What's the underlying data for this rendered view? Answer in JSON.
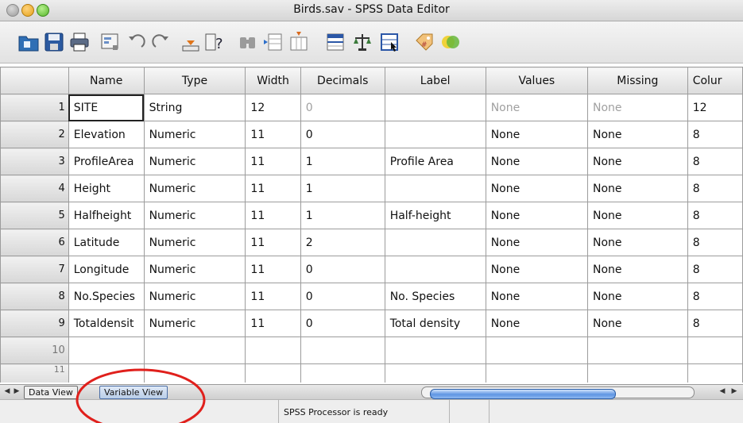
{
  "window": {
    "title": "Birds.sav - SPSS Data Editor"
  },
  "toolbar": {
    "icons": [
      "open-folder-icon",
      "save-icon",
      "print-icon",
      "dialog-recall-icon",
      "undo-icon",
      "redo-icon",
      "goto-case-icon",
      "variables-icon",
      "find-icon",
      "insert-cases-icon",
      "insert-variable-icon",
      "split-file-icon",
      "weight-cases-icon",
      "select-cases-icon",
      "value-labels-icon",
      "use-sets-icon"
    ]
  },
  "grid": {
    "columns": [
      "Name",
      "Type",
      "Width",
      "Decimals",
      "Label",
      "Values",
      "Missing",
      "Colur"
    ],
    "rows": [
      {
        "num": "1",
        "name": "SITE",
        "type": "String",
        "width": "12",
        "decimals": "0",
        "label": "",
        "values": "None",
        "missing": "None",
        "columns": "12"
      },
      {
        "num": "2",
        "name": "Elevation",
        "type": "Numeric",
        "width": "11",
        "decimals": "0",
        "label": "",
        "values": "None",
        "missing": "None",
        "columns": "8"
      },
      {
        "num": "3",
        "name": "ProfileArea",
        "type": "Numeric",
        "width": "11",
        "decimals": "1",
        "label": "Profile Area",
        "values": "None",
        "missing": "None",
        "columns": "8"
      },
      {
        "num": "4",
        "name": "Height",
        "type": "Numeric",
        "width": "11",
        "decimals": "1",
        "label": "",
        "values": "None",
        "missing": "None",
        "columns": "8"
      },
      {
        "num": "5",
        "name": "Halfheight",
        "type": "Numeric",
        "width": "11",
        "decimals": "1",
        "label": "Half-height",
        "values": "None",
        "missing": "None",
        "columns": "8"
      },
      {
        "num": "6",
        "name": "Latitude",
        "type": "Numeric",
        "width": "11",
        "decimals": "2",
        "label": "",
        "values": "None",
        "missing": "None",
        "columns": "8"
      },
      {
        "num": "7",
        "name": "Longitude",
        "type": "Numeric",
        "width": "11",
        "decimals": "0",
        "label": "",
        "values": "None",
        "missing": "None",
        "columns": "8"
      },
      {
        "num": "8",
        "name": "No.Species",
        "type": "Numeric",
        "width": "11",
        "decimals": "0",
        "label": "No. Species",
        "values": "None",
        "missing": "None",
        "columns": "8"
      },
      {
        "num": "9",
        "name": "Totaldensit",
        "type": "Numeric",
        "width": "11",
        "decimals": "0",
        "label": "Total density",
        "values": "None",
        "missing": "None",
        "columns": "8"
      }
    ],
    "empty_rows": [
      "10",
      "11"
    ]
  },
  "tabs": {
    "data_view": "Data View",
    "variable_view": "Variable View"
  },
  "status": {
    "text": "SPSS Processor  is ready"
  },
  "colors": {
    "annotation": "#e0201c",
    "scroll_thumb": "#5e95e3"
  }
}
